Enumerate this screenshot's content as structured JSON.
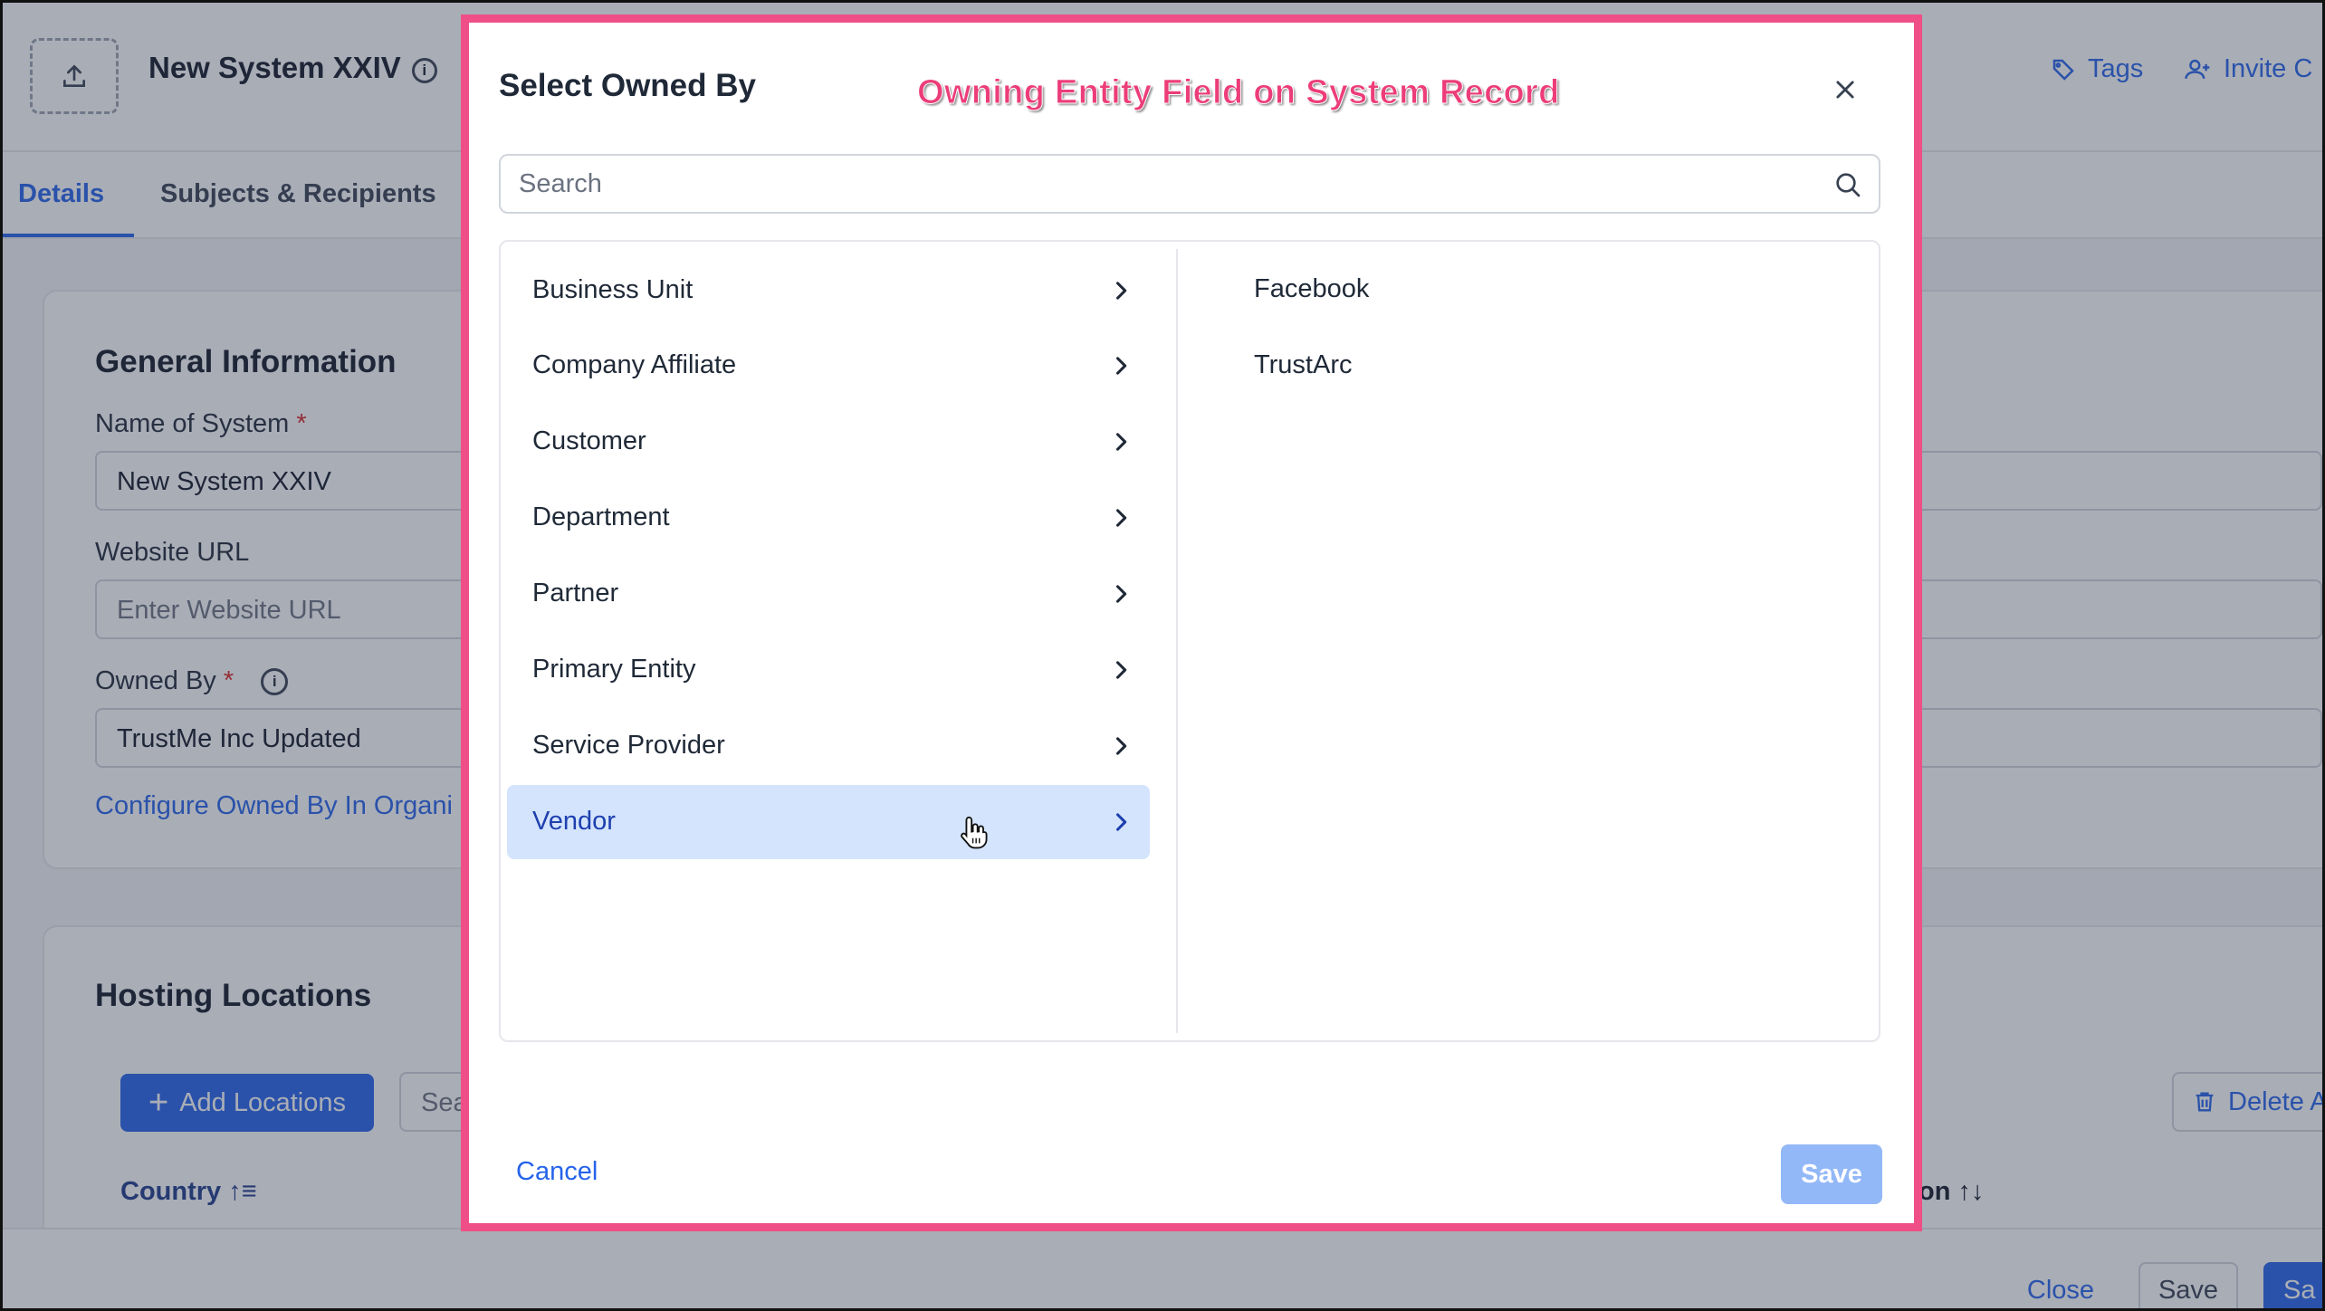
{
  "header": {
    "title": "New System XXIV",
    "tags_label": "Tags",
    "invite_label": "Invite C"
  },
  "tabs": [
    {
      "label": "Details"
    },
    {
      "label": "Subjects & Recipients"
    }
  ],
  "general_info": {
    "title": "General Information",
    "name_label": "Name of System",
    "name_value": "New System XXIV",
    "website_label": "Website URL",
    "website_placeholder": "Enter Website URL",
    "owned_label": "Owned By",
    "owned_value": "TrustMe Inc Updated",
    "configure_link": "Configure Owned By In Organi"
  },
  "hosting": {
    "title": "Hosting Locations",
    "add_label": "Add Locations",
    "search_partial": "Sea",
    "delete_label": "Delete A",
    "col_country": "Country",
    "col_right_partial": "on"
  },
  "footer": {
    "close_label": "Close",
    "save_label": "Save",
    "save2_partial": "Sa"
  },
  "modal": {
    "title": "Select Owned By",
    "annotation": "Owning Entity Field on System Record",
    "search_placeholder": "Search",
    "categories": [
      {
        "label": "Business Unit"
      },
      {
        "label": "Company Affiliate"
      },
      {
        "label": "Customer"
      },
      {
        "label": "Department"
      },
      {
        "label": "Partner"
      },
      {
        "label": "Primary Entity"
      },
      {
        "label": "Service Provider"
      },
      {
        "label": "Vendor"
      }
    ],
    "selected_category": "Vendor",
    "options": [
      {
        "label": "Facebook"
      },
      {
        "label": "TrustArc"
      }
    ],
    "cancel_label": "Cancel",
    "save_label": "Save"
  },
  "colors": {
    "accent": "#2563eb",
    "annotation_border": "#ef4f86",
    "selected_bg": "#d4e4fd",
    "save_disabled": "#93b8f8"
  }
}
